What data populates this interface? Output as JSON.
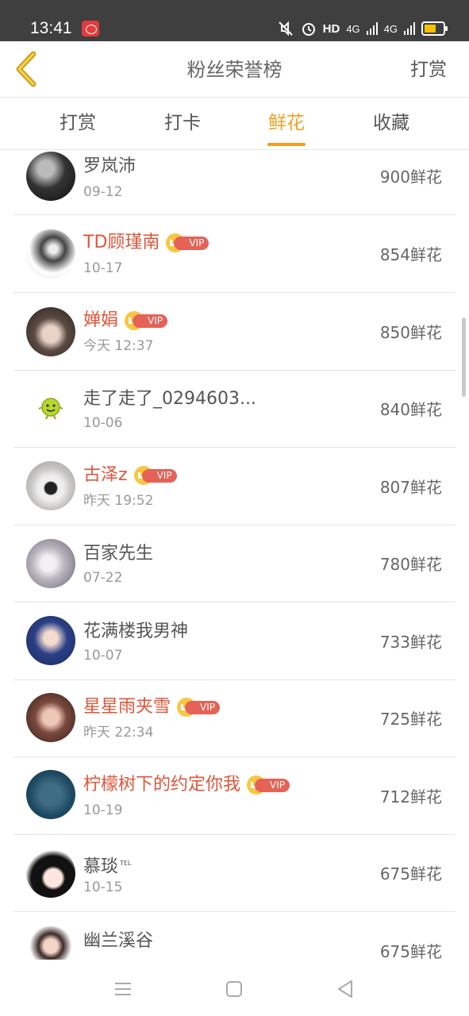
{
  "status_bar": {
    "time": "13:41",
    "network_label": "HD",
    "signal1": "4G",
    "signal2": "4G",
    "icons": [
      "app-notification-icon",
      "mute-icon",
      "alarm-icon",
      "hd-icon",
      "signal-icon",
      "battery-icon"
    ]
  },
  "header": {
    "title": "粉丝荣誉榜",
    "action": "打赏",
    "back_icon": "chevron-left-icon"
  },
  "tabs": [
    {
      "label": "打赏",
      "active": false
    },
    {
      "label": "打卡",
      "active": false
    },
    {
      "label": "鲜花",
      "active": true
    },
    {
      "label": "收藏",
      "active": false
    }
  ],
  "fans": [
    {
      "name": "罗岚沛",
      "date": "09-12",
      "count": "900鲜花",
      "vip": false
    },
    {
      "name": "TD顾瑾南",
      "date": "10-17",
      "count": "854鲜花",
      "vip": true
    },
    {
      "name": "婵娟",
      "date": "今天 12:37",
      "count": "850鲜花",
      "vip": true
    },
    {
      "name": "走了走了_0294603...",
      "date": "10-06",
      "count": "840鲜花",
      "vip": false
    },
    {
      "name": "古泽z",
      "date": "昨天 19:52",
      "count": "807鲜花",
      "vip": true
    },
    {
      "name": "百家先生",
      "date": "07-22",
      "count": "780鲜花",
      "vip": false
    },
    {
      "name": "花满楼我男神",
      "date": "10-07",
      "count": "733鲜花",
      "vip": false
    },
    {
      "name": "星星雨夹雪",
      "date": "昨天 22:34",
      "count": "725鲜花",
      "vip": true
    },
    {
      "name": "柠檬树下的约定你我",
      "date": "10-19",
      "count": "712鲜花",
      "vip": true
    },
    {
      "name": "慕琰",
      "date": "10-15",
      "count": "675鲜花",
      "vip": false,
      "tag": "TEL"
    },
    {
      "name": "幽兰溪谷",
      "date": "",
      "count": "675鲜花",
      "vip": false
    }
  ],
  "vip_label": "VIP",
  "colors": {
    "accent": "#f0a022",
    "vip_name": "#e0553a",
    "vip_badge": "#e46256",
    "crown": "#f8c742",
    "status_bar": "#3f3f3f"
  },
  "nav": [
    "menu-icon",
    "home-icon",
    "back-triangle-icon"
  ]
}
